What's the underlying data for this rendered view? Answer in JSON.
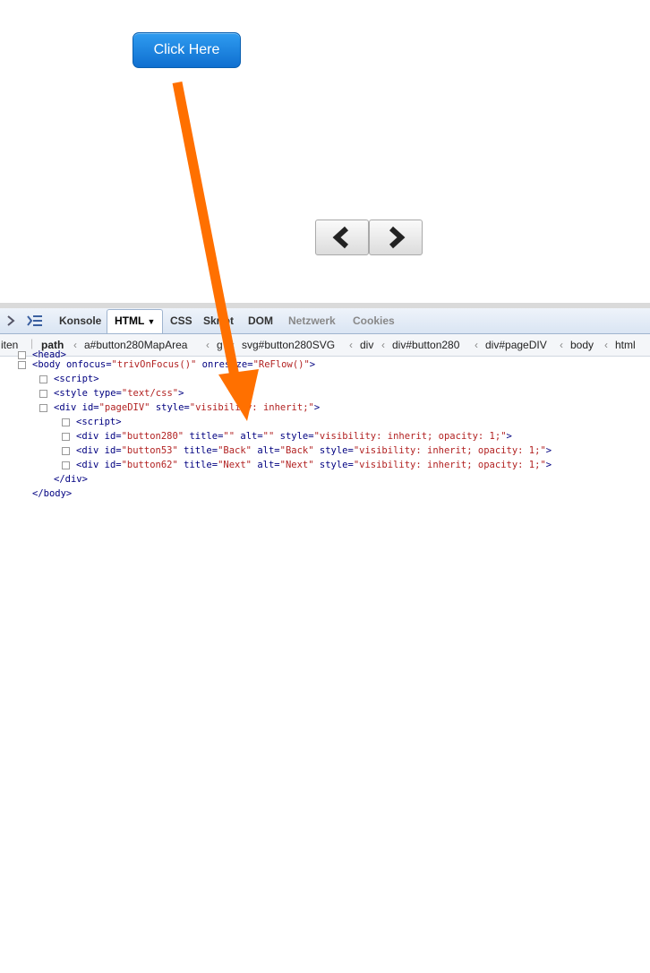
{
  "page": {
    "click_button_label": "Click Here",
    "colors": {
      "accent": "#1478dc",
      "arrow": "#ff7000"
    }
  },
  "devtools": {
    "tabs": [
      "Konsole",
      "HTML",
      "CSS",
      "Skript",
      "DOM",
      "Netzwerk",
      "Cookies"
    ],
    "active_tab": "HTML",
    "path_lead": "iten",
    "path_label": "path",
    "breadcrumb": [
      "a#button280MapArea",
      "g",
      "svg#button280SVG",
      "div",
      "div#button280",
      "div#pageDIV",
      "body",
      "html"
    ],
    "code": {
      "head": "<head>",
      "body_open": {
        "tag": "<body",
        "a1": "onfocus=",
        "v1": "\"trivOnFocus()\"",
        "a2": " onresize=",
        "v2": "\"ReFlow()\"",
        "end": ">"
      },
      "script1": "<script>",
      "style": {
        "tag": "<style",
        "a1": " type=",
        "v1": "\"text/css\"",
        "end": ">"
      },
      "div_page": {
        "tag": "<div",
        "a1": " id=",
        "v1": "\"pageDIV\"",
        "a2": " style=",
        "v2": "\"visibility: inherit;\"",
        "end": ">"
      },
      "script2": "<script>",
      "div_b280": {
        "tag": "<div",
        "a1": " id=",
        "v1": "\"button280\"",
        "a2": " title=",
        "v2": "\"\"",
        "a3": " alt=",
        "v3": "\"\"",
        "a4": " style=",
        "v4": "\"visibility: inherit; opacity: 1;\"",
        "end": ">"
      },
      "div_b53": {
        "tag": "<div",
        "a1": " id=",
        "v1": "\"button53\"",
        "a2": " title=",
        "v2": "\"Back\"",
        "a3": " alt=",
        "v3": "\"Back\"",
        "a4": " style=",
        "v4": "\"visibility: inherit; opacity: 1;\"",
        "end": ">"
      },
      "div_b62": {
        "tag": "<div",
        "a1": " id=",
        "v1": "\"button62\"",
        "a2": " title=",
        "v2": "\"Next\"",
        "a3": " alt=",
        "v3": "\"Next\"",
        "a4": " style=",
        "v4": "\"visibility: inherit; opacity: 1;\"",
        "end": ">"
      },
      "div_close": "</div>",
      "body_close": "</body>"
    }
  }
}
